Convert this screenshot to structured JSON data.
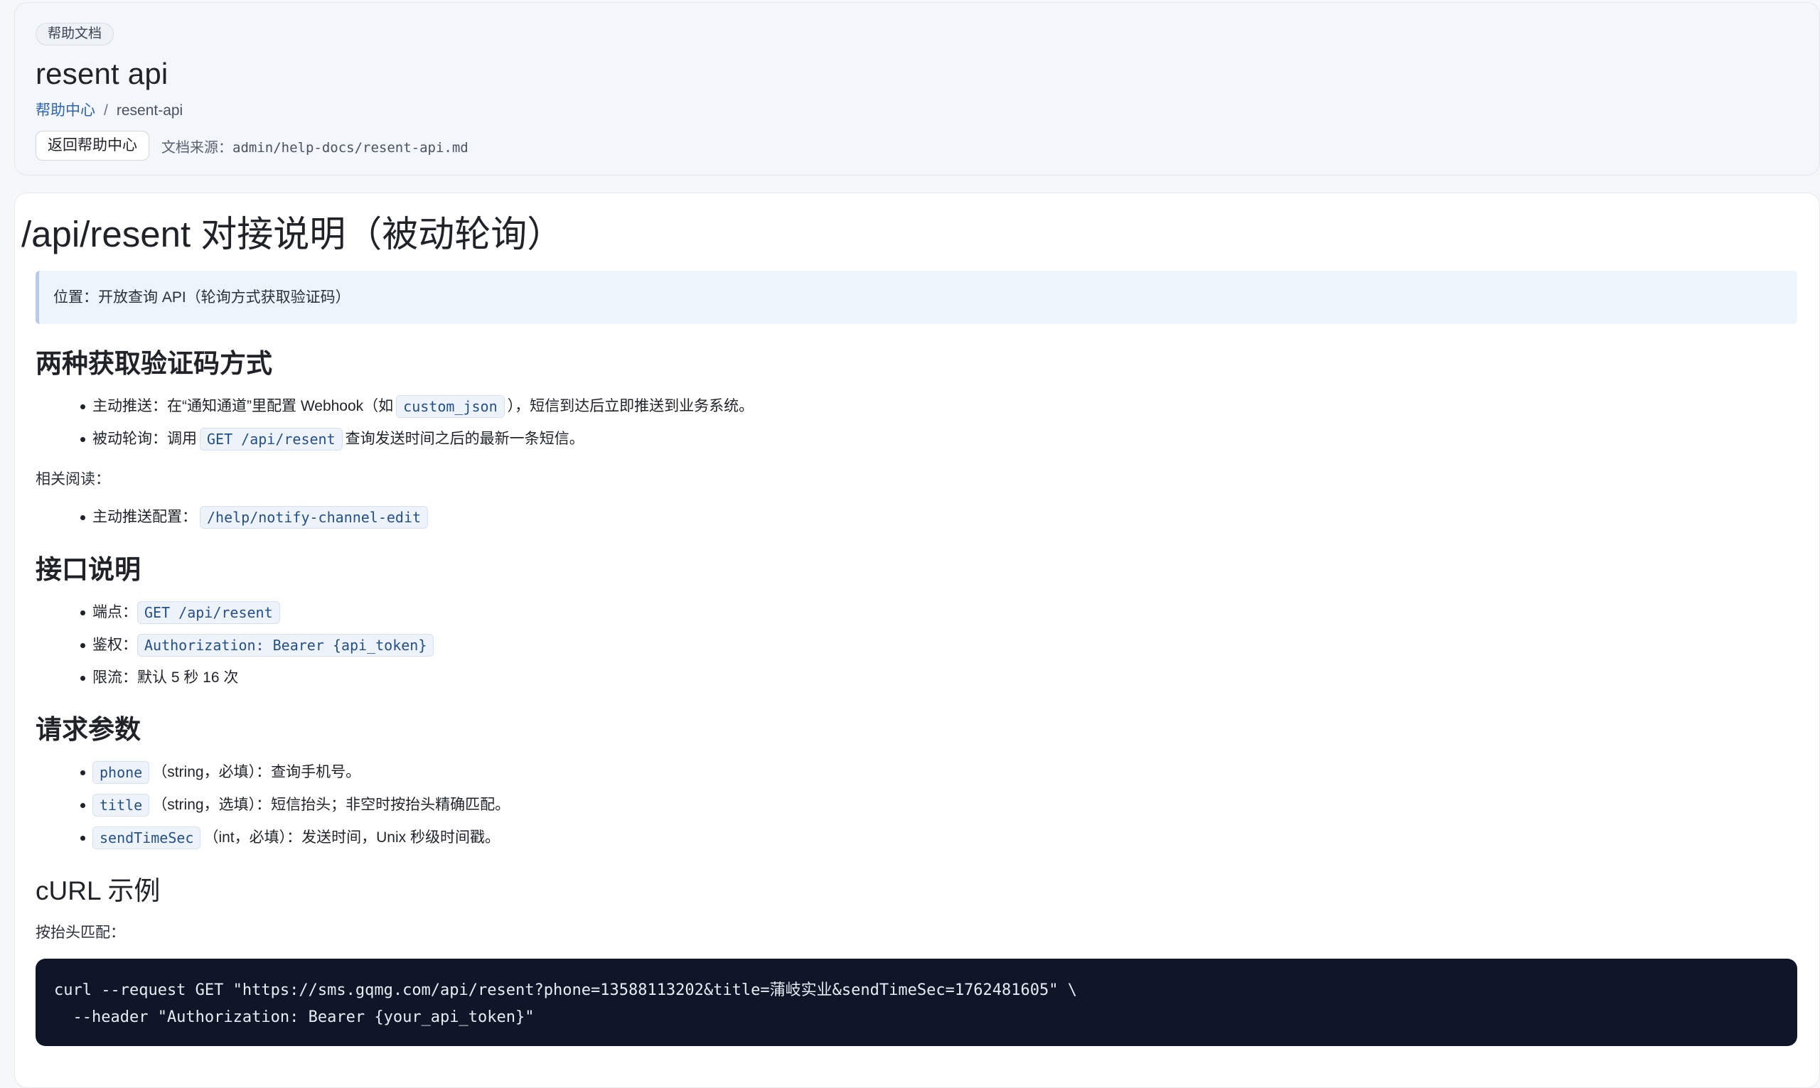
{
  "header": {
    "badge": "帮助文档",
    "title": "resent api",
    "breadcrumb": {
      "root": "帮助中心",
      "separator": "/",
      "current": "resent-api"
    },
    "back_button": "返回帮助中心",
    "source_label": "文档来源：",
    "source_path": "admin/help-docs/resent-api.md"
  },
  "doc": {
    "title": "/api/resent 对接说明（被动轮询）",
    "callout": "位置：开放查询 API（轮询方式获取验证码）",
    "section_methods": {
      "heading": "两种获取验证码方式",
      "items": [
        {
          "prefix": "主动推送：在“通知通道”里配置 Webhook（如",
          "code": "custom_json",
          "suffix": "），短信到达后立即推送到业务系统。"
        },
        {
          "prefix": "被动轮询：调用",
          "code": "GET /api/resent",
          "suffix": "查询发送时间之后的最新一条短信。"
        }
      ]
    },
    "related": {
      "label": "相关阅读：",
      "items": [
        {
          "prefix": "主动推送配置：",
          "code": "/help/notify-channel-edit",
          "suffix": ""
        }
      ]
    },
    "section_api": {
      "heading": "接口说明",
      "items": [
        {
          "prefix": "端点：",
          "code": "GET /api/resent",
          "suffix": ""
        },
        {
          "prefix": "鉴权：",
          "code": "Authorization: Bearer {api_token}",
          "suffix": ""
        },
        {
          "prefix": "限流：默认 5 秒 16 次",
          "code": "",
          "suffix": ""
        }
      ]
    },
    "section_params": {
      "heading": "请求参数",
      "items": [
        {
          "code": "phone",
          "suffix": "（string，必填）：查询手机号。"
        },
        {
          "code": "title",
          "suffix": "（string，选填）：短信抬头；非空时按抬头精确匹配。"
        },
        {
          "code": "sendTimeSec",
          "suffix": "（int，必填）：发送时间，Unix 秒级时间戳。"
        }
      ]
    },
    "section_curl": {
      "heading": "cURL 示例",
      "label": "按抬头匹配：",
      "code_line1": "curl --request GET \"https://sms.gqmg.com/api/resent?phone=13588113202&title=蒲岐实业&sendTimeSec=1762481605\" \\",
      "code_line2": "  --header \"Authorization: Bearer {your_api_token}\""
    }
  },
  "colors": {
    "link": "#2e63b8",
    "code_text": "#24508a",
    "code_bg": "#eef3fa",
    "codeblock_bg": "#0e1628"
  }
}
